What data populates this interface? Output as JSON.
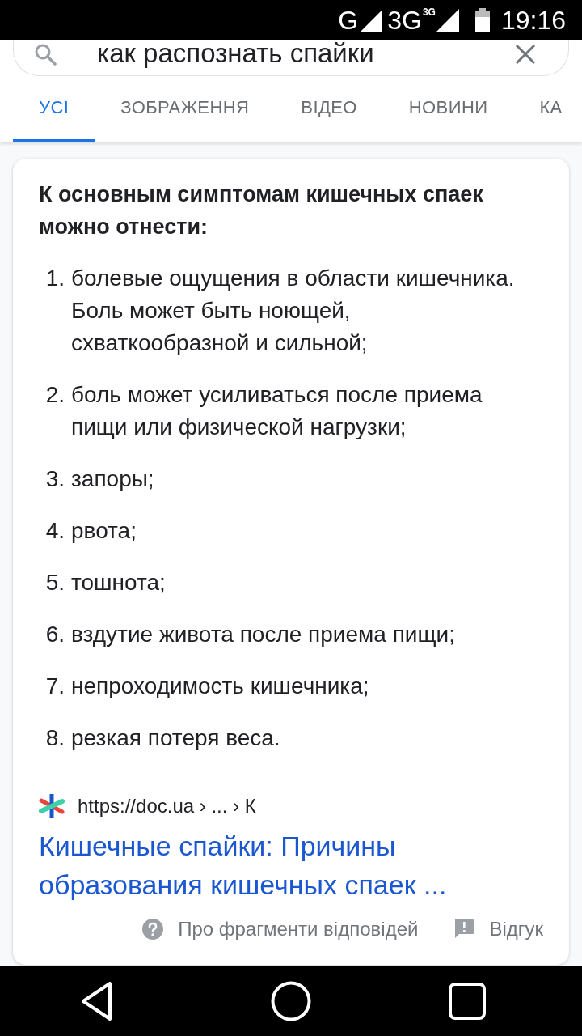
{
  "status_bar": {
    "network": "G",
    "mobile_network": "3G",
    "mobile_badge": "3G",
    "time": "19:16"
  },
  "search": {
    "value": "как распознать спайки"
  },
  "tabs": [
    {
      "label": "УСІ",
      "selected": true
    },
    {
      "label": "ЗОБРАЖЕННЯ",
      "selected": false
    },
    {
      "label": "ВІДЕО",
      "selected": false
    },
    {
      "label": "НОВИНИ",
      "selected": false
    },
    {
      "label": "КА",
      "selected": false
    }
  ],
  "snippet": {
    "heading": "К основным симптомам кишечных спаек можно отнести:",
    "items": [
      {
        "number": "1.",
        "text": "болевые ощущения в области кишечника. Боль может быть ноющей, схваткообразной и сильной;"
      },
      {
        "number": "2.",
        "text": "боль может усиливаться после приема пищи или физической нагрузки;"
      },
      {
        "number": "3.",
        "text": "запоры;"
      },
      {
        "number": "4.",
        "text": "рвота;"
      },
      {
        "number": "5.",
        "text": "тошнота;"
      },
      {
        "number": "6.",
        "text": "вздутие живота после приема пищи;"
      },
      {
        "number": "7.",
        "text": "непроходимость кишечника;"
      },
      {
        "number": "8.",
        "text": "резкая потеря веса."
      }
    ],
    "source": {
      "url": "https://doc.ua › ... › К",
      "title": "Кишечные спайки: Причины образования кишечных спаек ..."
    },
    "footer": {
      "about": "Про фрагменти відповідей",
      "feedback": "Відгук"
    }
  }
}
